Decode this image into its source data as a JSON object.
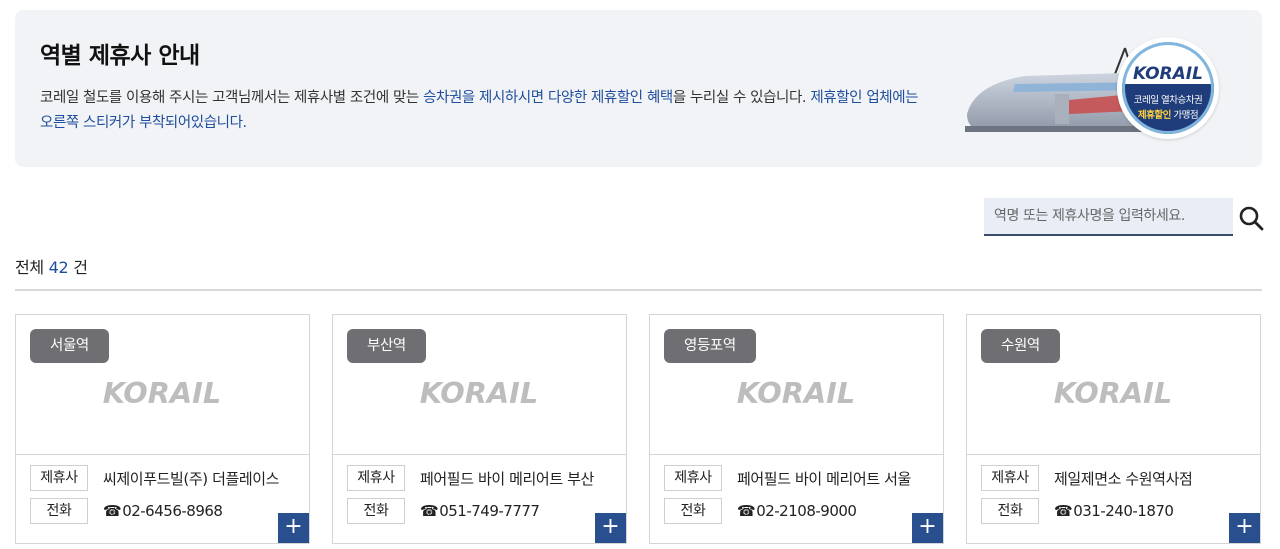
{
  "banner": {
    "title": "역별 제휴사 안내",
    "desc_part1": "코레일 철도를 이용해 주시는 고객님께서는 제휴사별 조건에 맞는 ",
    "desc_hl1": "승차권을 제시하시면 다양한 제휴할인 혜택",
    "desc_part2": "을 누리실 수 있습니다. ",
    "desc_hl2": "제휴할인 업체에는 오른쪽 스티커가 부착되어있습니다.",
    "badge_logo": "KORAIL",
    "badge_line1": "코레일 열차승차권",
    "badge_line2_hl": "제휴할인",
    "badge_line2_rest": " 가맹점"
  },
  "search": {
    "placeholder": "역명 또는 제휴사명을 입력하세요.",
    "icon": "search-icon"
  },
  "summary": {
    "prefix": "전체 ",
    "count": "42",
    "suffix": " 건"
  },
  "labels": {
    "partner": "제휴사",
    "phone": "전화",
    "logo": "KORAIL"
  },
  "cards": [
    {
      "station": "서울역",
      "partner": "씨제이푸드빌(주) 더플레이스",
      "phone": "02-6456-8968"
    },
    {
      "station": "부산역",
      "partner": "페어필드 바이 메리어트 부산",
      "phone": "051-749-7777"
    },
    {
      "station": "영등포역",
      "partner": "페어필드 바이 메리어트 서울",
      "phone": "02-2108-9000"
    },
    {
      "station": "수원역",
      "partner": "제일제면소 수원역사점",
      "phone": "031-240-1870"
    }
  ],
  "colors": {
    "accent": "#1f4e9c",
    "station_tag": "#6f6f73",
    "plus_button": "#2a4f8f",
    "banner_bg": "#f1f3f7"
  }
}
